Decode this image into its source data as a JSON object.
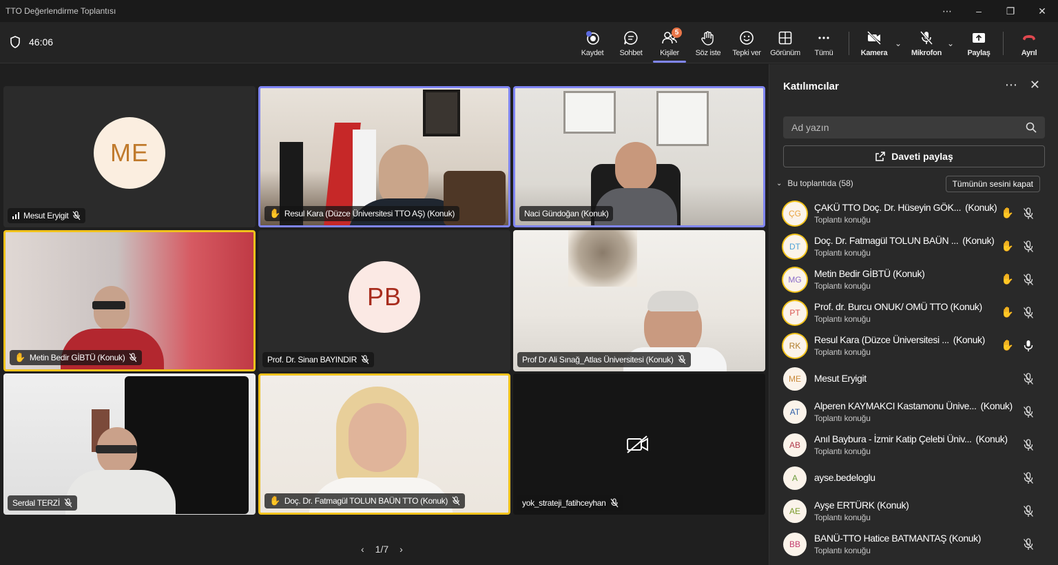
{
  "window": {
    "title": "TTO Değerlendirme Toplantısı"
  },
  "toolbar": {
    "timer": "46:06",
    "buttons": [
      {
        "id": "record",
        "label": "Kaydet"
      },
      {
        "id": "chat",
        "label": "Sohbet"
      },
      {
        "id": "people",
        "label": "Kişiler",
        "badge": "5"
      },
      {
        "id": "raise",
        "label": "Söz iste"
      },
      {
        "id": "react",
        "label": "Tepki ver"
      },
      {
        "id": "view",
        "label": "Görünüm"
      },
      {
        "id": "more",
        "label": "Tümü"
      },
      {
        "id": "camera",
        "label": "Kamera"
      },
      {
        "id": "mic",
        "label": "Mikrofon"
      },
      {
        "id": "share",
        "label": "Paylaş"
      },
      {
        "id": "leave",
        "label": "Ayrıl"
      }
    ]
  },
  "stage": {
    "tiles": [
      {
        "name": "Mesut Eryigit",
        "initials": "ME",
        "video": false,
        "state": "normal"
      },
      {
        "name": "Resul Kara (Düzce Üniversitesi TTO AŞ) (Konuk)",
        "video": true,
        "state": "selected",
        "hand": true
      },
      {
        "name": "Naci Gündoğan (Konuk)",
        "video": true,
        "state": "selected"
      },
      {
        "name": "Metin Bedir GİBTÜ (Konuk)",
        "video": true,
        "state": "speaking",
        "hand": true
      },
      {
        "name": "Prof. Dr. Sinan BAYINDIR",
        "initials": "PB",
        "video": false,
        "state": "normal"
      },
      {
        "name": "Prof Dr Ali Sınağ_Atlas Üniversitesi (Konuk)",
        "video": true,
        "state": "normal"
      },
      {
        "name": "Serdal TERZİ",
        "video": true,
        "state": "normal"
      },
      {
        "name": "Doç. Dr. Fatmagül TOLUN BAÜN TTO (Konuk)",
        "video": true,
        "state": "speaking",
        "hand": true
      },
      {
        "name": "yok_strateji_fatihceyhan",
        "video": false,
        "camoff": true,
        "state": "normal"
      }
    ],
    "pager": "1/7"
  },
  "panel": {
    "title": "Katılımcılar",
    "search_placeholder": "Ad yazın",
    "invite_label": "Daveti paylaş",
    "section_label": "Bu toplantıda (58)",
    "mute_all_label": "Tümünün sesini kapat",
    "participants": [
      {
        "initials": "ÇG",
        "name": "ÇAKÜ TTO Doç. Dr. Hüseyin GÖK...",
        "tag": "(Konuk)",
        "sub": "Toplantı konuğu",
        "hand": true,
        "mic": "off",
        "color": "#e8a33d"
      },
      {
        "initials": "DT",
        "name": "Doç. Dr. Fatmagül TOLUN BAÜN ...",
        "tag": "(Konuk)",
        "sub": "Toplantı konuğu",
        "hand": true,
        "mic": "off",
        "color": "#4fa3d8"
      },
      {
        "initials": "MG",
        "name": "Metin Bedir GİBTÜ (Konuk)",
        "tag": "",
        "sub": "Toplantı konuğu",
        "hand": true,
        "mic": "off",
        "color": "#8a6bc9"
      },
      {
        "initials": "PT",
        "name": "Prof. dr. Burcu ONUK/ OMÜ TTO (Konuk)",
        "tag": "",
        "sub": "Toplantı konuğu",
        "hand": true,
        "mic": "off",
        "color": "#d9534f"
      },
      {
        "initials": "RK",
        "name": "Resul Kara (Düzce Üniversitesi ...",
        "tag": "(Konuk)",
        "sub": "Toplantı konuğu",
        "hand": true,
        "mic": "on",
        "color": "#b07c2a"
      },
      {
        "initials": "ME",
        "name": "Mesut Eryigit",
        "tag": "",
        "sub": "",
        "hand": false,
        "mic": "off",
        "color": "#c98a3a"
      },
      {
        "initials": "AT",
        "name": "Alperen KAYMAKCI Kastamonu Ünive...",
        "tag": "(Konuk)",
        "sub": "Toplantı konuğu",
        "hand": false,
        "mic": "off",
        "color": "#2f5fa8"
      },
      {
        "initials": "AB",
        "name": "Anıl Baybura - İzmir Katip Çelebi Üniv...",
        "tag": "(Konuk)",
        "sub": "Toplantı konuğu",
        "hand": false,
        "mic": "off",
        "color": "#b03a4a"
      },
      {
        "initials": "A",
        "name": "ayse.bedeloglu",
        "tag": "",
        "sub": "",
        "hand": false,
        "mic": "off",
        "color": "#6c9b3a"
      },
      {
        "initials": "AE",
        "name": "Ayşe ERTÜRK (Konuk)",
        "tag": "",
        "sub": "Toplantı konuğu",
        "hand": false,
        "mic": "off",
        "color": "#7a9b2a"
      },
      {
        "initials": "BB",
        "name": "BANÜ-TTO Hatice BATMANTAŞ (Konuk)",
        "tag": "",
        "sub": "Toplantı konuğu",
        "hand": false,
        "mic": "off",
        "color": "#c23b6d"
      }
    ]
  }
}
